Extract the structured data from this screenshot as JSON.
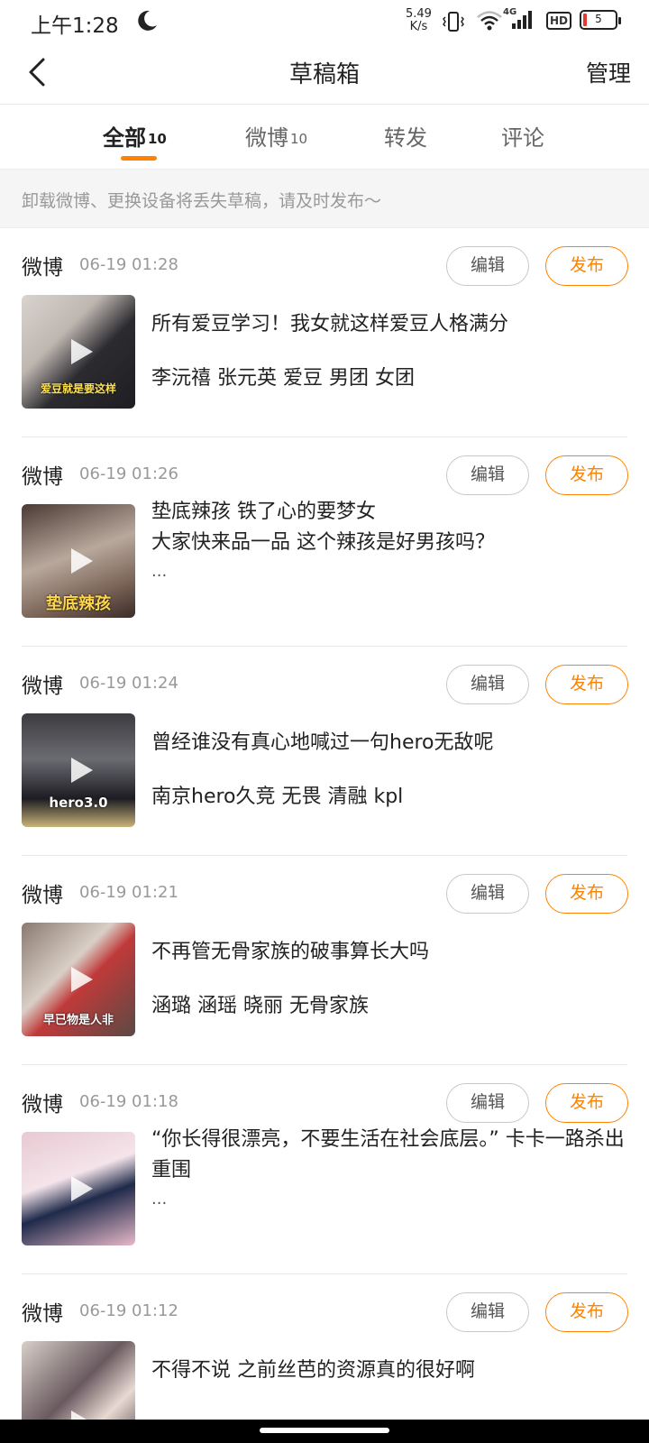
{
  "status_bar": {
    "time": "上午1:28",
    "net_speed_value": "5.49",
    "net_speed_unit": "K/s",
    "signal_type": "4G",
    "hd_label": "HD",
    "battery": "5",
    "icons": [
      "moon-icon",
      "vibrate-icon",
      "wifi-icon",
      "cell-signal-icon",
      "battery-icon"
    ]
  },
  "nav": {
    "title": "草稿箱",
    "manage": "管理"
  },
  "tabs": [
    {
      "label": "全部",
      "count": "10",
      "active": true
    },
    {
      "label": "微博",
      "count": "10",
      "active": false
    },
    {
      "label": "转发",
      "count": "",
      "active": false
    },
    {
      "label": "评论",
      "count": "",
      "active": false
    }
  ],
  "notice": "卸载微博、更换设备将丢失草稿，请及时发布～",
  "buttons": {
    "edit": "编辑",
    "publish": "发布"
  },
  "drafts": [
    {
      "source": "微博",
      "time": "06-19 01:28",
      "text": "所有爱豆学习！我女就这样爱豆人格满分",
      "tags": "李沅禧 张元英 爱豆 男团 女团",
      "ellipsis": "",
      "thumb_caption": "爱豆就是要这样"
    },
    {
      "source": "微博",
      "time": "06-19 01:26",
      "text": "垫底辣孩 铁了心的要梦女\n大家快来品一品 这个辣孩是好男孩吗？",
      "tags": "",
      "ellipsis": "...",
      "thumb_caption": "垫底辣孩"
    },
    {
      "source": "微博",
      "time": "06-19 01:24",
      "text": "曾经谁没有真心地喊过一句hero无敌呢",
      "tags": "南京hero久竞 无畏 清融 kpl",
      "ellipsis": "",
      "thumb_caption": "hero3.0"
    },
    {
      "source": "微博",
      "time": "06-19 01:21",
      "text": "不再管无骨家族的破事算长大吗",
      "tags": "涵璐 涵瑶 晓丽 无骨家族",
      "ellipsis": "",
      "thumb_caption": "早已物是人非"
    },
    {
      "source": "微博",
      "time": "06-19 01:18",
      "text": "“你长得很漂亮，不要生活在社会底层。” 卡卡一路杀出重围",
      "tags": "",
      "ellipsis": "...",
      "thumb_caption": ""
    },
    {
      "source": "微博",
      "time": "06-19 01:12",
      "text": "不得不说 之前丝芭的资源真的很好啊",
      "tags": "",
      "ellipsis": "",
      "thumb_caption": ""
    }
  ],
  "colors": {
    "accent": "#ff8200",
    "text_primary": "#222222",
    "text_secondary": "#999999",
    "notice_bg": "#f5f5f5"
  }
}
